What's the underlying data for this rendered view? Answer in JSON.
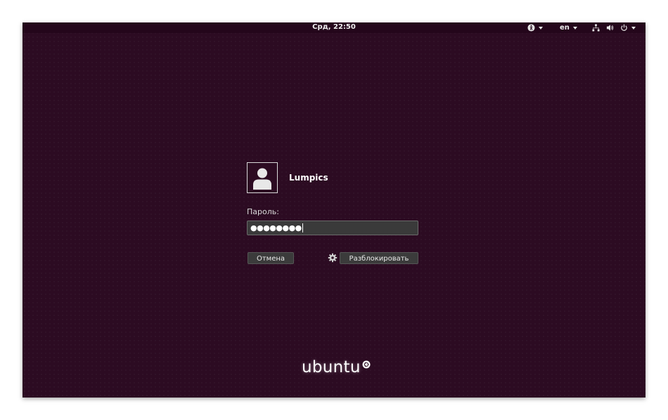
{
  "topbar": {
    "clock": "Срд, 22:50",
    "language": "en",
    "icons": [
      "accessibility-icon",
      "network-icon",
      "volume-icon",
      "power-icon"
    ]
  },
  "login": {
    "username": "Lumpics",
    "password_label": "Пароль:",
    "password_masked": "●●●●●●●●",
    "cancel_label": "Отмена",
    "unlock_label": "Разблокировать"
  },
  "branding": {
    "logo_text": "ubuntu"
  },
  "colors": {
    "background": "#2c0b22",
    "topbar": "#24061b",
    "button": "#3b3b3b",
    "text": "#ffffff"
  }
}
